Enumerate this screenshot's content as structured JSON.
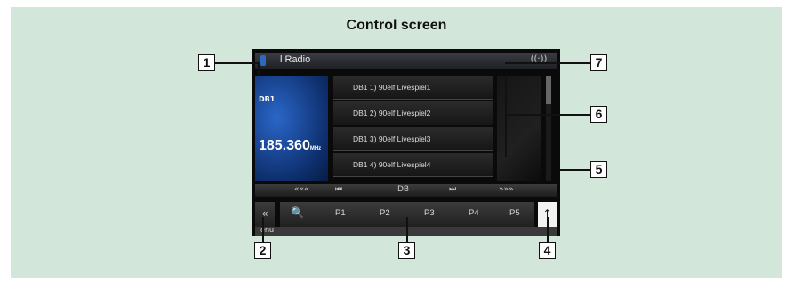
{
  "figure": {
    "title": "Control screen"
  },
  "screen": {
    "source_label": "Digital Radio",
    "source_label_visible": "l Radio",
    "antenna_glyph": "((·))",
    "art": {
      "band": "DB1",
      "frequency": "185.360",
      "unit": "MHz"
    },
    "presets": [
      "DB1 1) 90elf Livespiel1",
      "DB1 2) 90elf Livespiel2",
      "DB1 3) 90elf Livespiel3",
      "DB1 4) 90elf Livespiel4"
    ],
    "controls": {
      "fast_rewind": "«««",
      "prev": "⏮",
      "band": "DB",
      "next": "⏭",
      "fast_forward": "»»»"
    },
    "preset_bar": {
      "search_glyph": "🔍",
      "buttons": [
        "P1",
        "P2",
        "P3",
        "P4",
        "P5"
      ]
    },
    "left_button": "«",
    "right_button": "↑",
    "menu_label": "enu"
  },
  "callouts": [
    "1",
    "2",
    "3",
    "4",
    "5",
    "6",
    "7"
  ]
}
